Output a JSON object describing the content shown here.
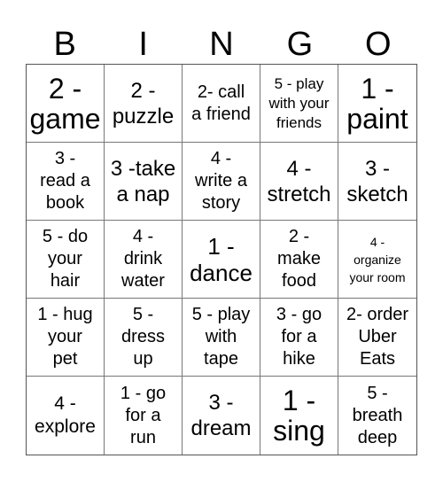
{
  "header": [
    "B",
    "I",
    "N",
    "G",
    "O"
  ],
  "cells": [
    "2 -\ngame",
    "2 -\npuzzle",
    "2- call\na friend",
    "5 - play\nwith your\nfriends",
    "1 -\npaint",
    "3 -\nread a\nbook",
    "3 -take\na nap",
    "4 -\nwrite a\nstory",
    "4 -\nstretch",
    "3 -\nsketch",
    "5 - do\nyour\nhair",
    "4 -\ndrink\nwater",
    "1 -\ndance",
    "2 -\nmake\nfood",
    "4 -\norganize\nyour room",
    "1 - hug\nyour\npet",
    "5 -\ndress\nup",
    "5 - play\nwith\ntape",
    "3 - go\nfor a\nhike",
    "2- order\nUber\nEats",
    "4 -\nexplore",
    "1 - go\nfor a\nrun",
    "3 -\ndream",
    "1 -\nsing",
    "5 -\nbreath\ndeep"
  ]
}
